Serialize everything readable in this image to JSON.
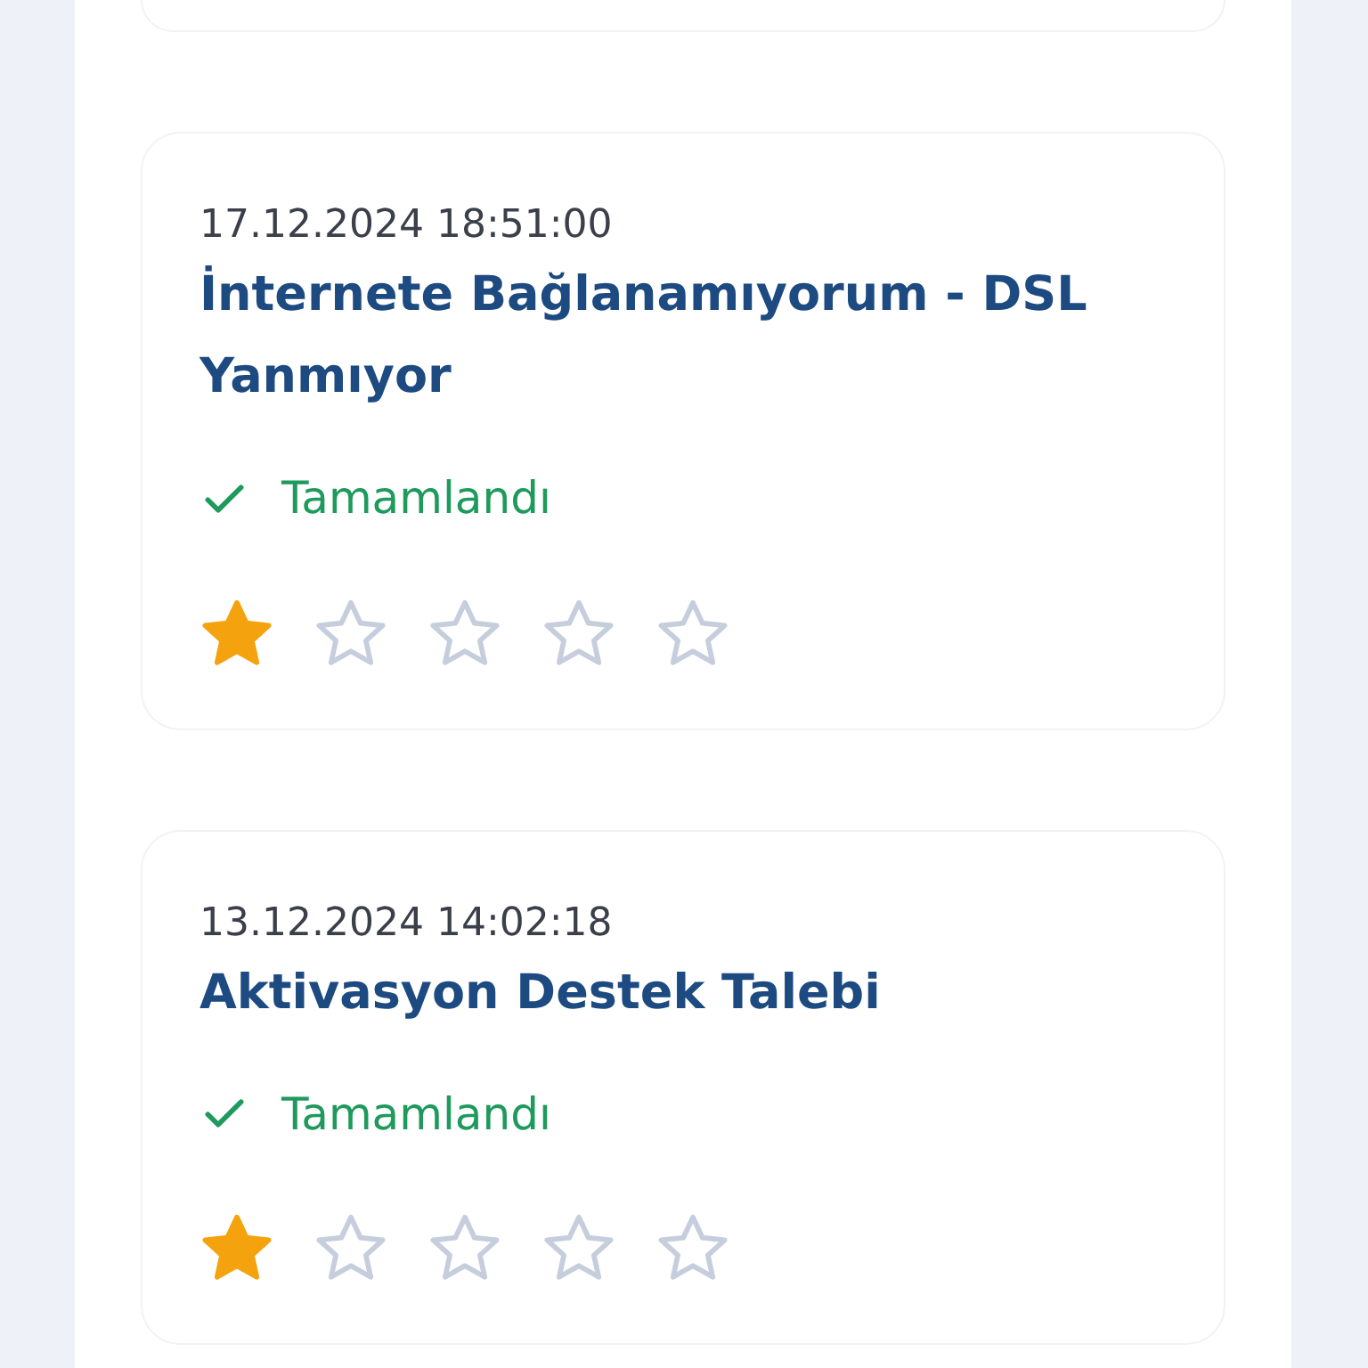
{
  "tickets": [
    {
      "date": "17.12.2024 18:51:00",
      "title": "İnternete Bağlanamıyorum - DSL Yanmıyor",
      "status": {
        "kind": "completed",
        "label": "Tamamlandı"
      },
      "stars": 1
    },
    {
      "date": "13.12.2024 14:02:18",
      "title": "Aktivasyon Destek Talebi",
      "status": {
        "kind": "completed",
        "label": "Tamamlandı"
      },
      "stars": 1
    }
  ]
}
